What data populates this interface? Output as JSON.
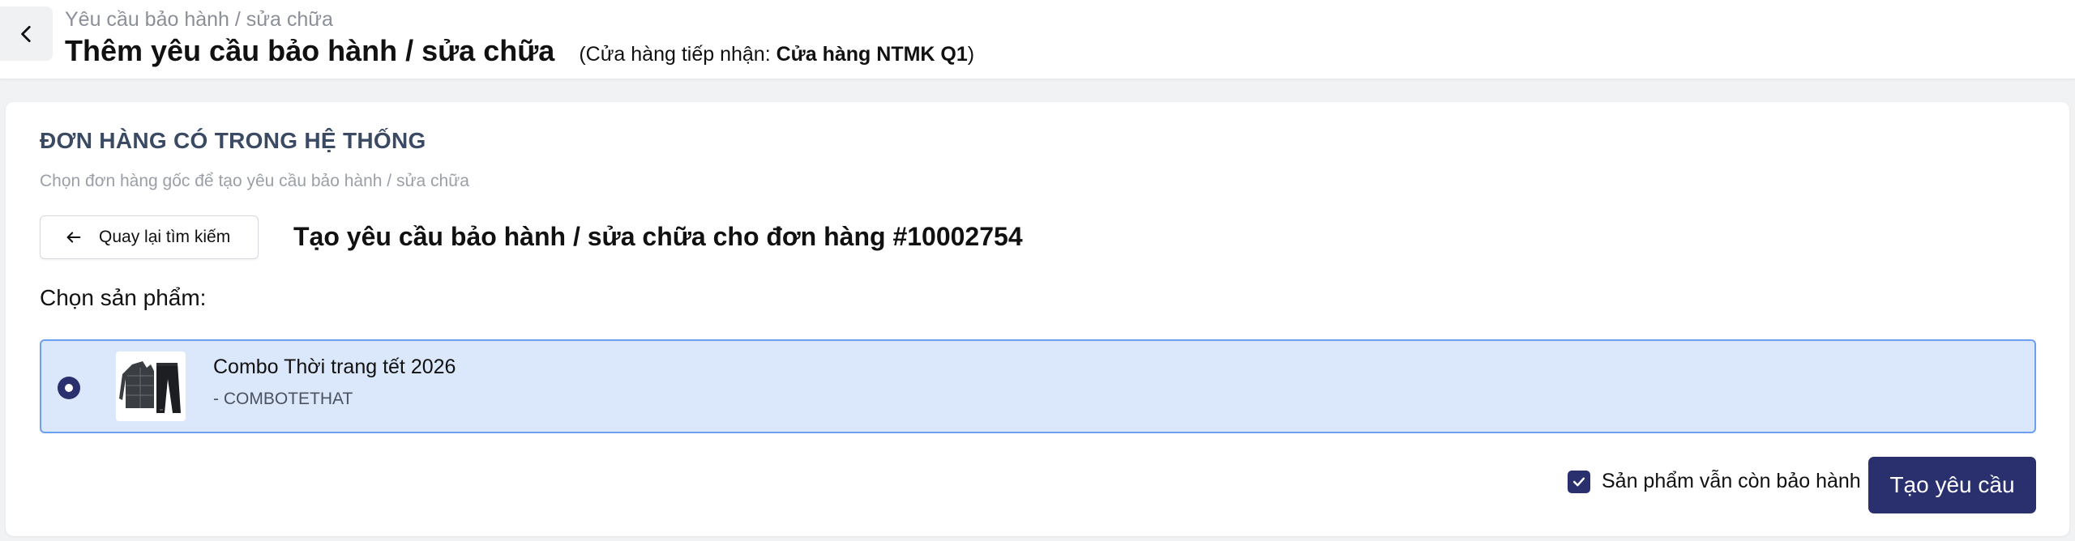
{
  "header": {
    "breadcrumb": "Yêu cầu bảo hành / sửa chữa",
    "title": "Thêm yêu cầu bảo hành / sửa chữa",
    "store_prefix": "(Cửa hàng tiếp nhận: ",
    "store_name": "Cửa hàng NTMK Q1",
    "store_suffix": ")",
    "back_icon": "chevron-left-icon"
  },
  "section": {
    "title": "ĐƠN HÀNG CÓ TRONG HỆ THỐNG",
    "subtitle": "Chọn đơn hàng gốc để tạo yêu cầu bảo hành / sửa chữa",
    "back_search_label": "Quay lại tìm kiếm",
    "back_search_icon": "arrow-left-icon",
    "order_heading": "Tạo yêu cầu bảo hành / sửa chữa cho đơn hàng #10002754",
    "choose_product_label": "Chọn sản phẩm:"
  },
  "products": [
    {
      "name": "Combo Thời trang tết 2026",
      "sku": "- COMBOTETHAT",
      "selected": true
    }
  ],
  "footer": {
    "warranty_label": "Sản phẩm vẫn còn bảo hành",
    "warranty_checked": true,
    "submit_label": "Tạo yêu cầu"
  },
  "colors": {
    "primary": "#2a2f6e",
    "selected_bg": "#dbe8fb",
    "selected_border": "#6c9ff0",
    "section_title": "#3b4a63"
  }
}
